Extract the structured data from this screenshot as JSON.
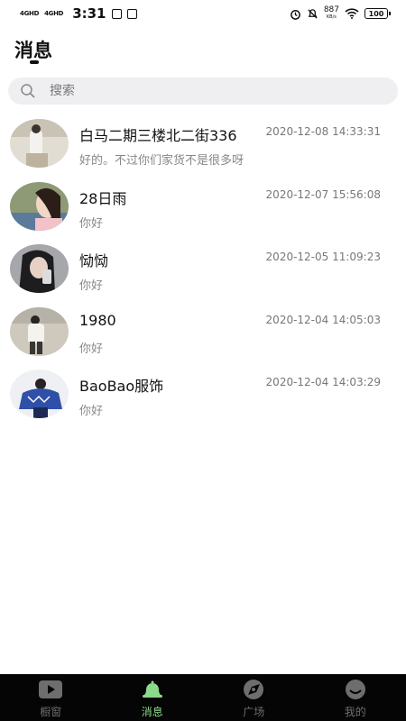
{
  "status_bar": {
    "signal_1": "4GHD",
    "signal_2": "4GHD",
    "time": "3:31",
    "net_speed": "887",
    "net_speed_unit": "KB/s",
    "battery": "100"
  },
  "header": {
    "title": "消息"
  },
  "search": {
    "placeholder": "搜索"
  },
  "conversations": [
    {
      "name": "白马二期三楼北二街336",
      "time": "2020-12-08 14:33:31",
      "preview": "好的。不过你们家货不是很多呀",
      "avatar_color": "#d8d2c4"
    },
    {
      "name": "28日雨",
      "time": "2020-12-07 15:56:08",
      "preview": "你好",
      "avatar_color": "#7f8d6a"
    },
    {
      "name": "恸恸",
      "time": "2020-12-05 11:09:23",
      "preview": "你好",
      "avatar_color": "#9a9ba0"
    },
    {
      "name": "1980",
      "time": "2020-12-04 14:05:03",
      "preview": "你好",
      "avatar_color": "#b9b3a6"
    },
    {
      "name": "BaoBao服饰",
      "time": "2020-12-04 14:03:29",
      "preview": "你好",
      "avatar_color": "#2f4fa8"
    }
  ],
  "bottom_nav": {
    "items": [
      {
        "label": "橱窗",
        "icon": "play-icon"
      },
      {
        "label": "消息",
        "icon": "bell-icon"
      },
      {
        "label": "广场",
        "icon": "compass-icon"
      },
      {
        "label": "我的",
        "icon": "face-icon"
      }
    ],
    "active_color": "#8dd98a",
    "inactive_color": "#6e6e6e"
  }
}
